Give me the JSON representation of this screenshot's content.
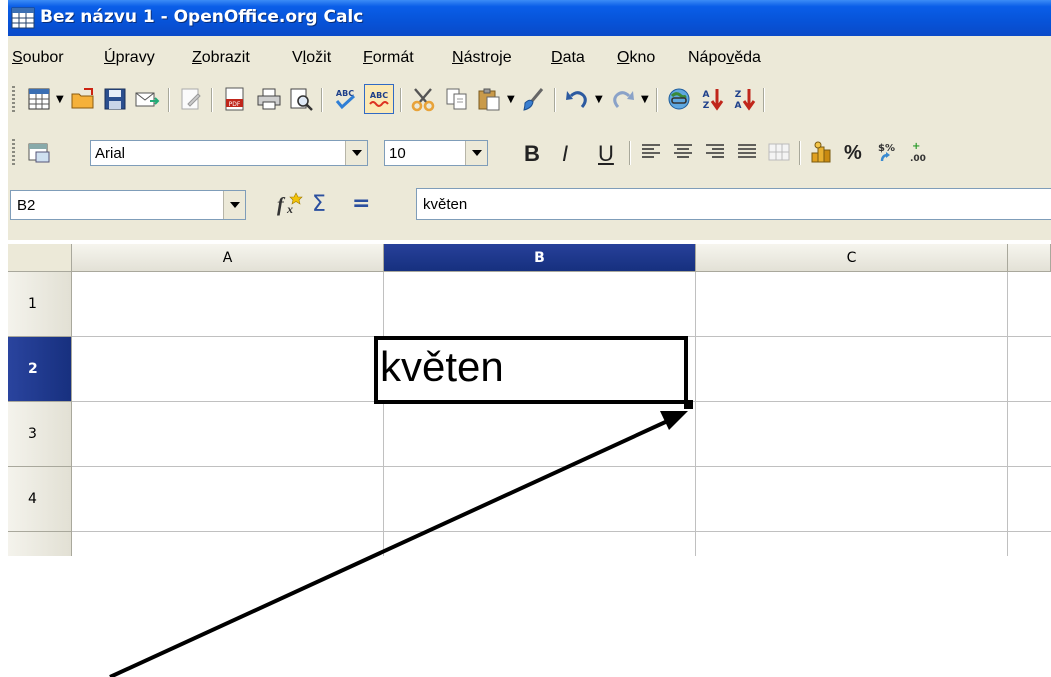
{
  "window": {
    "title": "Bez názvu 1 - OpenOffice.org Calc"
  },
  "menu": {
    "items": [
      {
        "label": "Soubor",
        "mnemonic": "S",
        "rest": "oubor"
      },
      {
        "label": "Úpravy",
        "mnemonic": "Ú",
        "rest": "pravy",
        "pre": ""
      },
      {
        "label": "Zobrazit",
        "mnemonic": "Z",
        "rest": "obrazit"
      },
      {
        "label": "Vložit",
        "pre": "V",
        "mnemonic": "l",
        "rest": "ožit"
      },
      {
        "label": "Formát",
        "mnemonic": "F",
        "rest": "ormát"
      },
      {
        "label": "Nástroje",
        "mnemonic": "N",
        "rest": "ástroje"
      },
      {
        "label": "Data",
        "mnemonic": "D",
        "rest": "ata"
      },
      {
        "label": "Okno",
        "mnemonic": "O",
        "rest": "kno"
      },
      {
        "label": "Nápověda",
        "pre": "Nápo",
        "mnemonic": "v",
        "rest": "ěda"
      }
    ]
  },
  "format_toolbar": {
    "font_name": "Arial",
    "font_size": "10",
    "bold_label": "B",
    "italic_label": "I",
    "underline_label": "U",
    "percent_label": "%"
  },
  "formula_bar": {
    "cell_reference": "B2",
    "sum_symbol": "Σ",
    "equals_symbol": "=",
    "content": "květen"
  },
  "sheet": {
    "columns": [
      "A",
      "B",
      "C"
    ],
    "rows": [
      "1",
      "2",
      "3",
      "4"
    ],
    "active_column": "B",
    "active_row": "2",
    "cells": {
      "B2": "květen"
    }
  },
  "colors": {
    "titlebar": "#0753d8",
    "active_header": "#1f3a8f",
    "chrome": "#ece9d8"
  }
}
